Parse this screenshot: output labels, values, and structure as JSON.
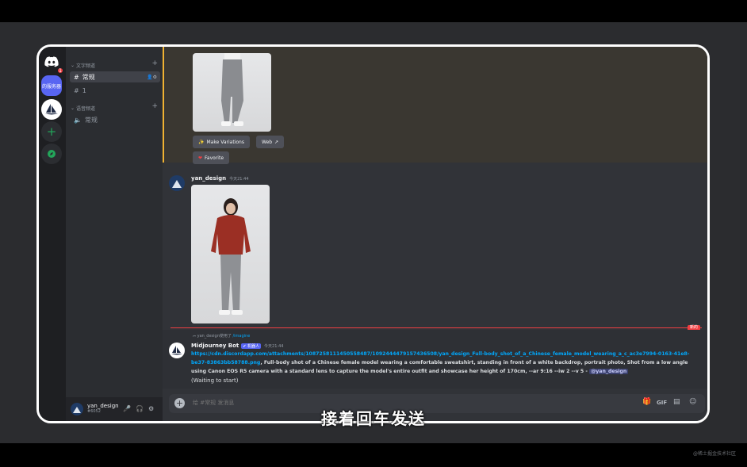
{
  "server_rail": {
    "notification_count": "1",
    "server_label": "的服务器"
  },
  "sidebar": {
    "text_category": "文字频道",
    "channels": [
      {
        "label": "常规"
      },
      {
        "label": "1"
      }
    ],
    "voice_category": "语音频道",
    "voice_channels": [
      {
        "label": "常规"
      }
    ]
  },
  "user": {
    "name": "yan_design",
    "tag": "#6052"
  },
  "messages": {
    "first_buttons": {
      "make_variations": "Make Variations",
      "web": "Web",
      "favorite": "Favorite"
    },
    "second": {
      "author": "yan_design",
      "time": "今天21:44"
    },
    "new_label": "新的",
    "third": {
      "reply_user": "yan_design使用了",
      "reply_command": "/imagine",
      "author": "Midjourney Bot",
      "bot_tag": "✔ 机器人",
      "time": "今天21:44",
      "link": "https://cdn.discordapp.com/attachments/1087258111450558487/1092444479157436508/yan_design_Full-body_shot_of_a_Chinese_female_model_wearing_a_c_ac3e7994-0163-41e8-be37-83863bb58788.png",
      "prompt": ", Full-body shot of a Chinese female model wearing a comfortable sweatshirt, standing in front of a white backdrop, portrait photo, Shot from a low angle using Canon EOS R5 camera with a standard lens to capture the model's entire outfit and showcase her height of 170cm, --ar 9:16 --iw 2 --v 5 - ",
      "mention": "@yan_design",
      "status": "(Waiting to start)"
    }
  },
  "composer": {
    "placeholder": "给 #常规 发消息"
  },
  "subtitle": "接着回车发送",
  "watermark": "@稀土掘金技术社区",
  "colors": {
    "accent": "#5865f2",
    "link": "#00a8fc",
    "new_marker": "#f23f42",
    "online": "#23a55a"
  }
}
